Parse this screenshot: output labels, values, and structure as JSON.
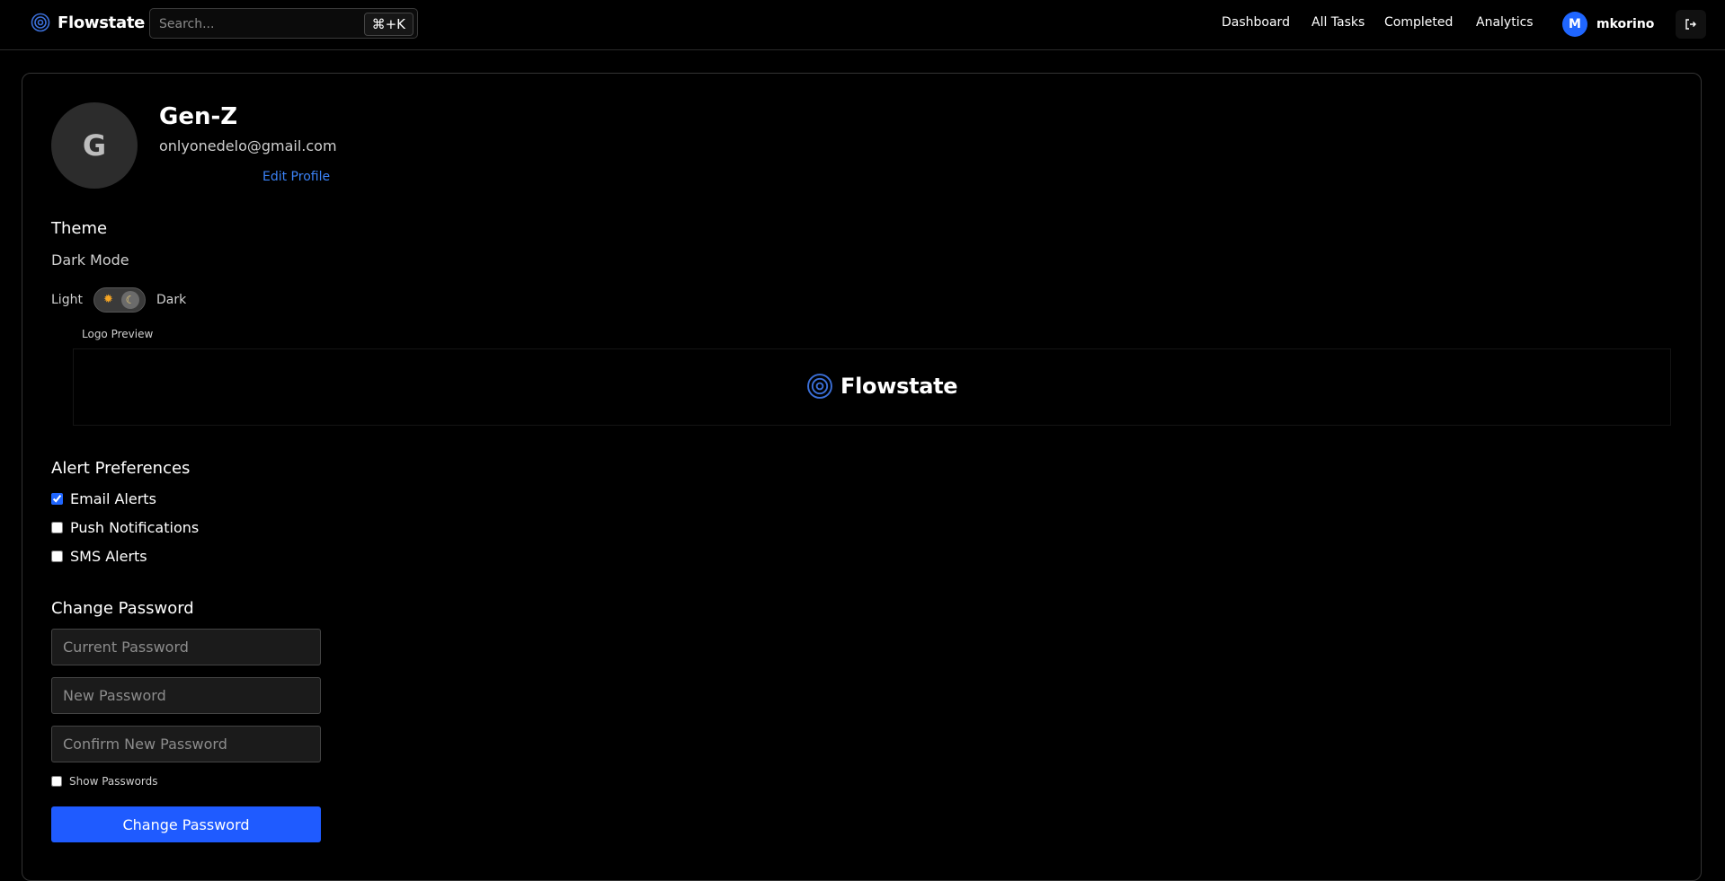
{
  "header": {
    "brand": "Flowstate",
    "search_placeholder": "Search...",
    "search_shortcut": "⌘+K",
    "nav": [
      {
        "label": "Dashboard"
      },
      {
        "label": "All Tasks"
      },
      {
        "label": "Completed"
      },
      {
        "label": "Analytics"
      }
    ],
    "user": {
      "initial": "M",
      "name": "mkorino"
    }
  },
  "profile": {
    "initial": "G",
    "name": "Gen-Z",
    "email": "onlyonedelo@gmail.com",
    "edit_label": "Edit Profile"
  },
  "theme": {
    "title": "Theme",
    "subtitle": "Dark Mode",
    "light_label": "Light",
    "dark_label": "Dark",
    "mode": "dark",
    "logo_preview_label": "Logo Preview",
    "logo_text": "Flowstate"
  },
  "alerts": {
    "title": "Alert Preferences",
    "items": [
      {
        "label": "Email Alerts",
        "checked": true
      },
      {
        "label": "Push Notifications",
        "checked": false
      },
      {
        "label": "SMS Alerts",
        "checked": false
      }
    ]
  },
  "password": {
    "title": "Change Password",
    "current_placeholder": "Current Password",
    "new_placeholder": "New Password",
    "confirm_placeholder": "Confirm New Password",
    "show_label": "Show Passwords",
    "submit_label": "Change Password"
  },
  "colors": {
    "accent": "#1f5bff",
    "link": "#3b82f6",
    "background": "#000000"
  }
}
